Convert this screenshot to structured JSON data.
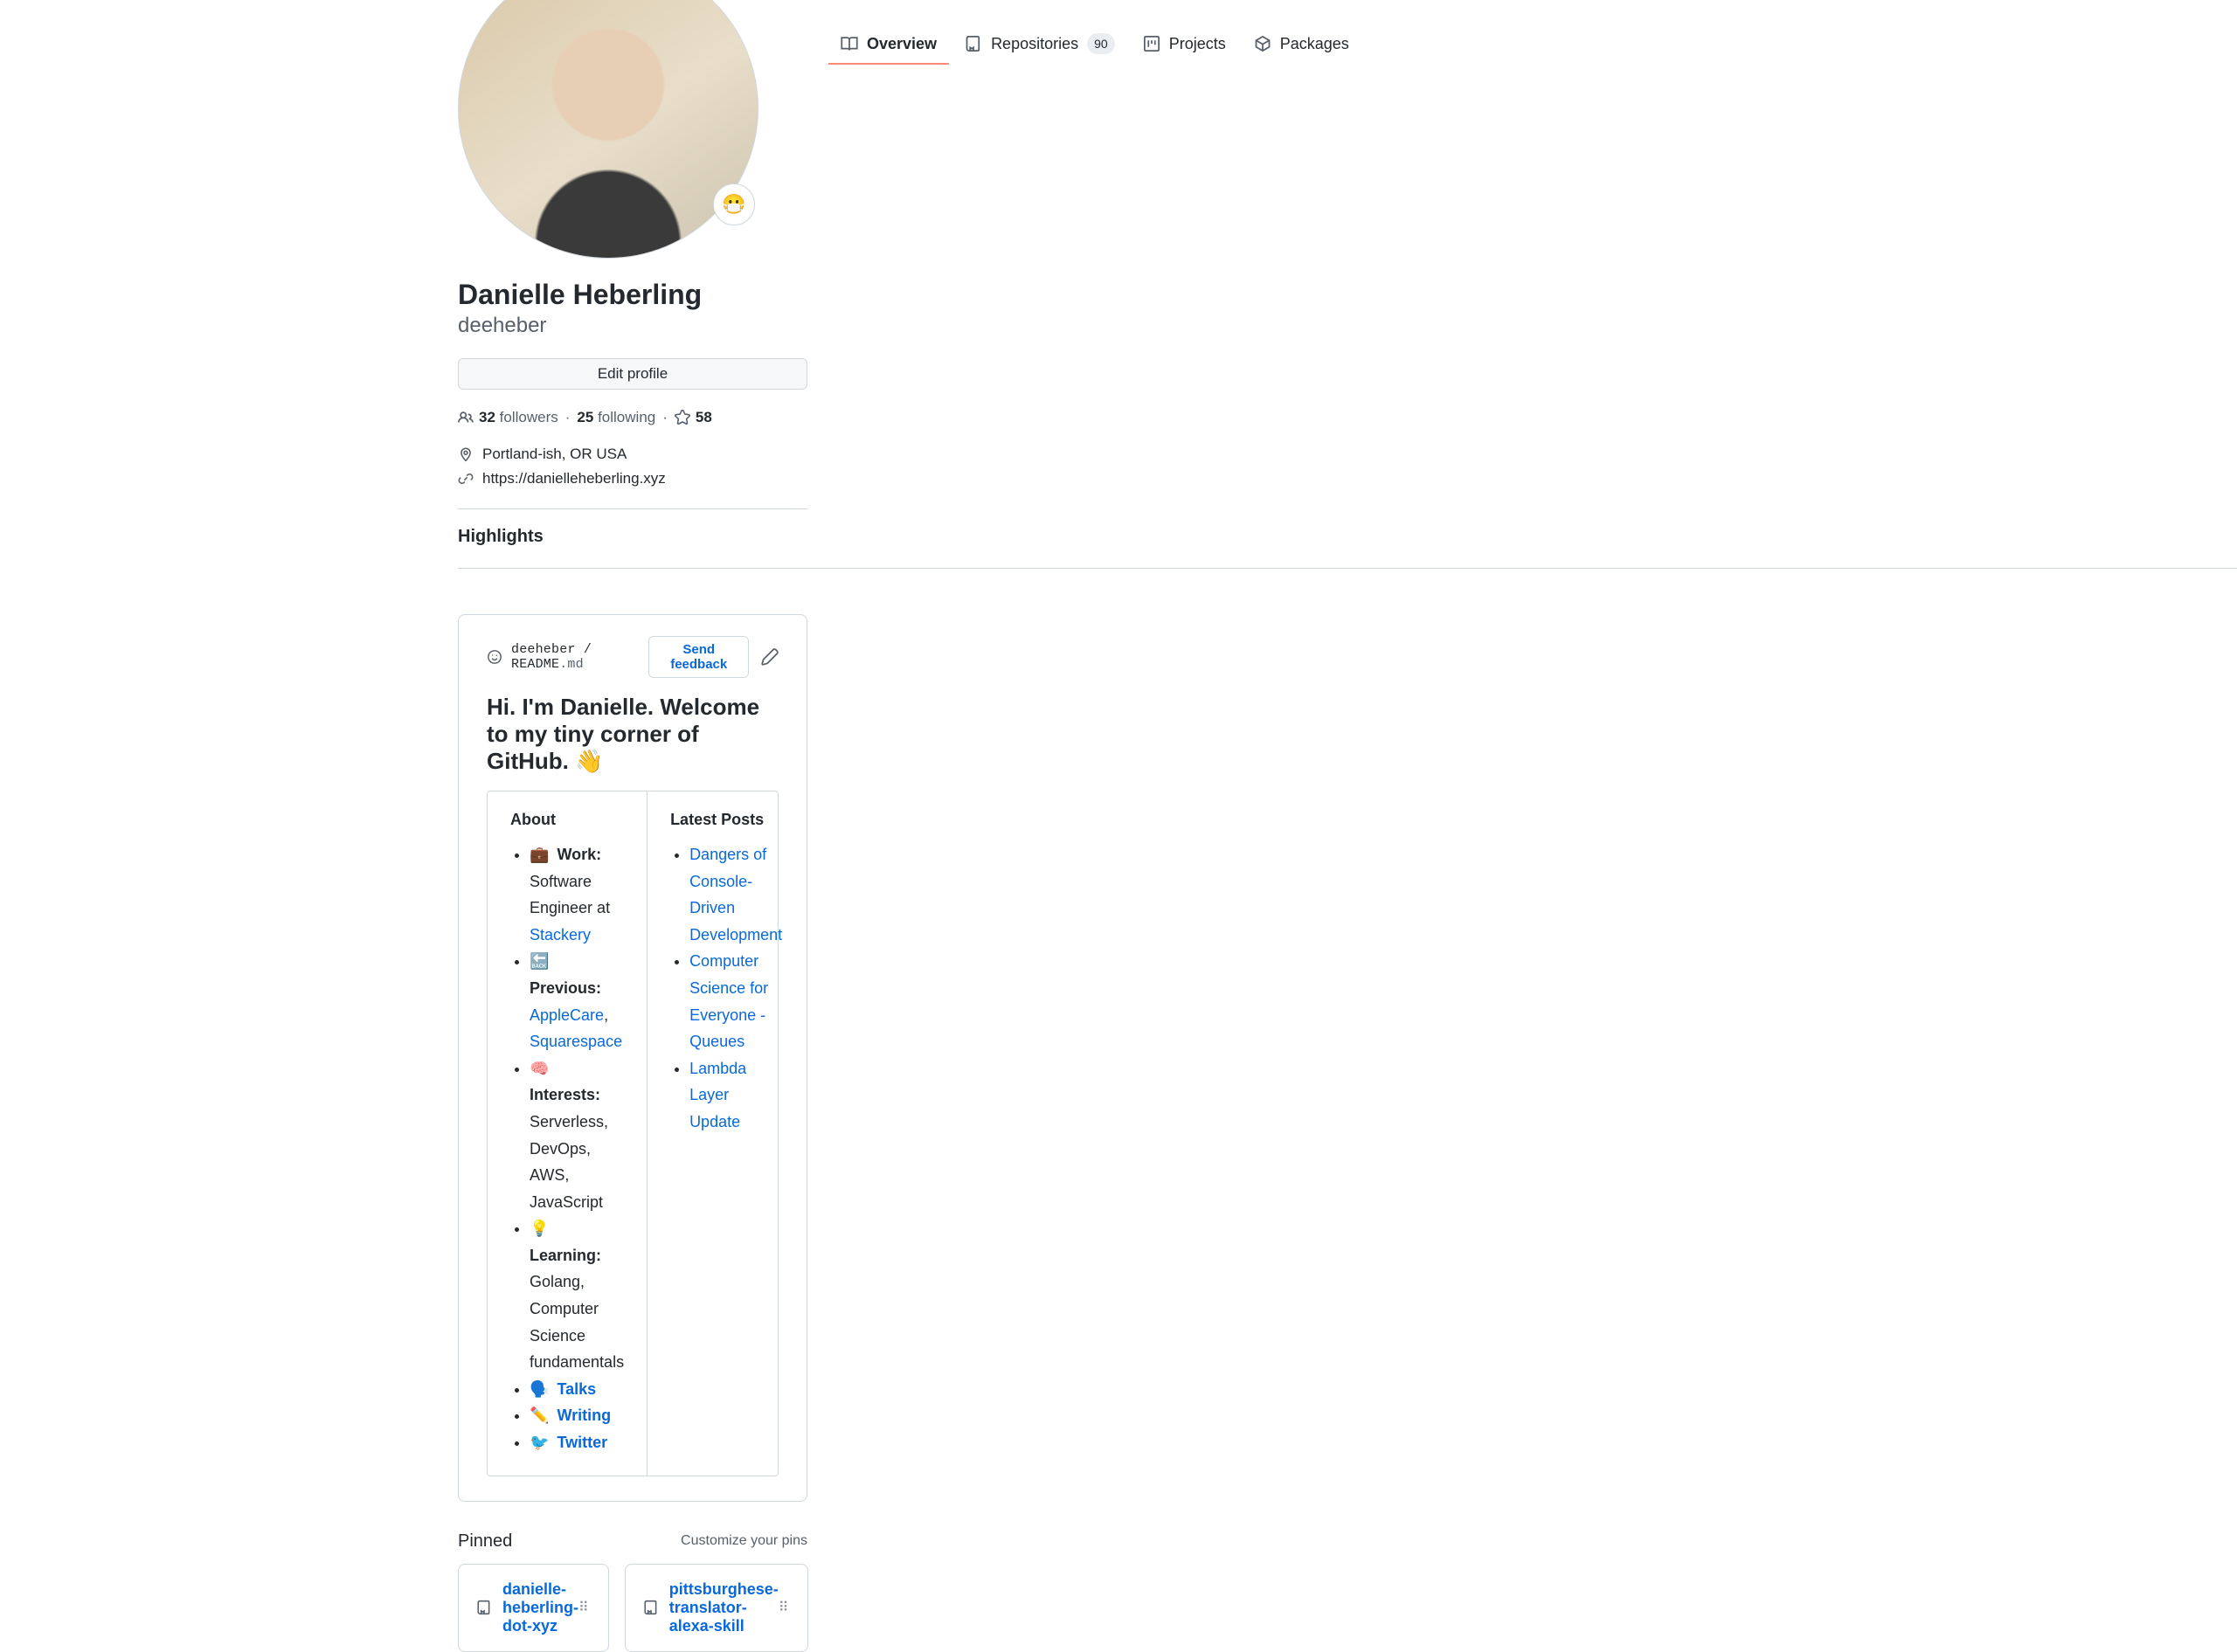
{
  "tabs": {
    "overview": "Overview",
    "repos": "Repositories",
    "repos_count": "90",
    "projects": "Projects",
    "packages": "Packages"
  },
  "profile": {
    "status_emoji": "😷",
    "fullname": "Danielle Heberling",
    "username": "deeheber",
    "edit_label": "Edit profile",
    "followers_count": "32",
    "followers_label": "followers",
    "following_count": "25",
    "following_label": "following",
    "stars_count": "58",
    "location": "Portland-ish, OR USA",
    "website": "https://danielleheberling.xyz",
    "highlights_heading": "Highlights"
  },
  "readme": {
    "path_user": "deeheber",
    "path_file": "README",
    "path_ext": ".md",
    "feedback_label": "Send feedback",
    "title": "Hi. I'm Danielle. Welcome to my tiny corner of GitHub. 👋",
    "about_heading": "About",
    "posts_heading": "Latest Posts",
    "about": {
      "work_label": "Work:",
      "work_text": "Software Engineer at ",
      "work_link": "Stackery",
      "prev_label": "Previous:",
      "prev_link1": "AppleCare",
      "prev_sep": ", ",
      "prev_link2": "Squarespace",
      "interests_label": "Interests:",
      "interests_text": "Serverless, DevOps, AWS, JavaScript",
      "learning_label": "Learning:",
      "learning_text": "Golang, Computer Science fundamentals",
      "talks_link": "Talks",
      "writing_link": "Writing",
      "twitter_link": "Twitter"
    },
    "posts": {
      "p1": "Dangers of Console-Driven Development",
      "p2": "Computer Science for Everyone - Queues",
      "p3": "Lambda Layer Update"
    }
  },
  "pinned": {
    "heading": "Pinned",
    "customize": "Customize your pins",
    "card1": "danielle-heberling-dot-xyz",
    "card2": "pittsburghese-translator-alexa-skill"
  }
}
